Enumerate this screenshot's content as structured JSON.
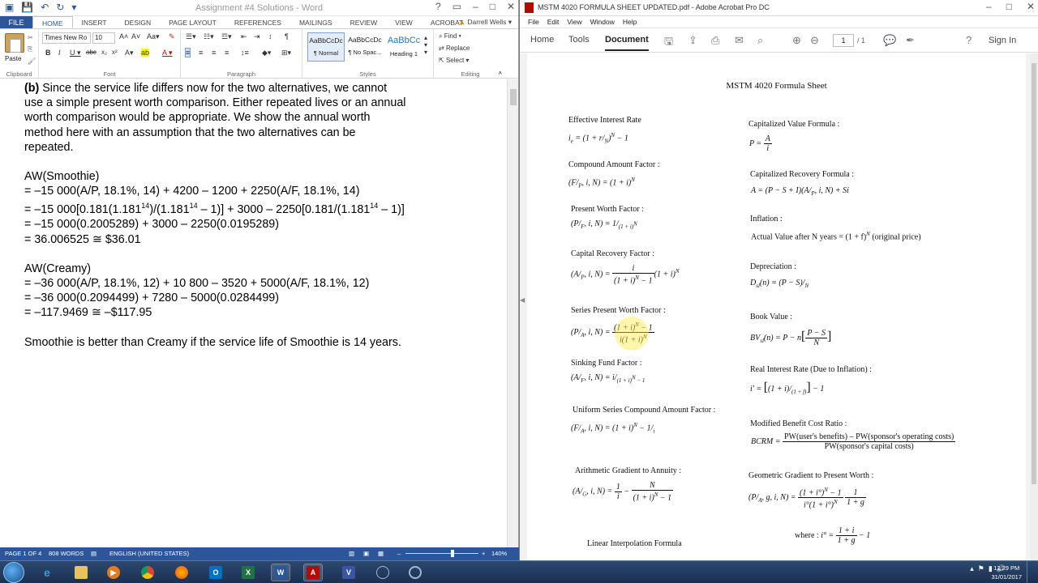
{
  "word": {
    "title": "Assignment #4 Solutions - Word",
    "tabs": [
      "FILE",
      "HOME",
      "INSERT",
      "DESIGN",
      "PAGE LAYOUT",
      "REFERENCES",
      "MAILINGS",
      "REVIEW",
      "VIEW",
      "ACROBAT"
    ],
    "active_tab": "HOME",
    "user": "Darrell Wells",
    "ribbon": {
      "font_name": "Times New Ro",
      "font_size": "10",
      "paste_label": "Paste",
      "groups": [
        "Clipboard",
        "Font",
        "Paragraph",
        "Styles",
        "Editing"
      ],
      "styles": [
        {
          "preview": "AaBbCcDc",
          "name": "¶ Normal"
        },
        {
          "preview": "AaBbCcDc",
          "name": "¶ No Spac..."
        },
        {
          "preview": "AaBbCc",
          "name": "Heading 1"
        }
      ],
      "editing": [
        "Find",
        "Replace",
        "Select"
      ]
    },
    "doc": {
      "para_b_label": "(b)",
      "para_b_line1": " Since the service life differs now for the two alternatives, we cannot",
      "para_b_lines": [
        "use a simple present worth comparison. Either repeated lives or an annual",
        "worth comparison would be appropriate. We show the annual worth",
        "method here with an assumption that the two alternatives can be",
        "repeated."
      ],
      "smoothie_head": "AW(Smoothie)",
      "smoothie_l1": "= –15 000(A/P, 18.1%, 14) + 4200 – 1200 + 2250(A/F, 18.1%, 14)",
      "smoothie_l2": "= –15 000[0.181(1.181",
      "smoothie_l2_sup1": "14",
      "smoothie_l2_b": ")/(1.181",
      "smoothie_l2_sup2": "14",
      "smoothie_l2_c": " – 1)] + 3000 – 2250[0.181/(1.181",
      "smoothie_l2_sup3": "14",
      "smoothie_l2_d": " – 1)]",
      "smoothie_l3": "= –15 000(0.2005289) + 3000 – 2250(0.0195289)",
      "smoothie_l4": "= 36.006525 ≅ $36.01",
      "creamy_head": "AW(Creamy)",
      "creamy_l1": "= –36 000(A/P, 18.1%, 12) + 10 800 – 3520 + 5000(A/F, 18.1%, 12)",
      "creamy_l2": "= –36 000(0.2094499) + 7280 – 5000(0.0284499)",
      "creamy_l3": "= –117.9469 ≅ –$117.95",
      "conclusion": "Smoothie is better than Creamy if the service life of Smoothie is 14 years."
    },
    "status": {
      "page": "PAGE 1 OF 4",
      "words": "808 WORDS",
      "language": "ENGLISH (UNITED STATES)",
      "zoom": "140%"
    }
  },
  "acrobat": {
    "title": "MSTM 4020 FORMULA SHEET UPDATED.pdf - Adobe Acrobat Pro DC",
    "menu": [
      "File",
      "Edit",
      "View",
      "Window",
      "Help"
    ],
    "nav": [
      "Home",
      "Tools",
      "Document"
    ],
    "active_nav": "Document",
    "page_current": "1",
    "page_total": "/ 1",
    "sign_in": "Sign In",
    "sheet": {
      "title": "MSTM 4020 Formula Sheet",
      "left_labels": [
        "Effective Interest Rate",
        "Compound Amount Factor :",
        "Present Worth Factor :",
        "Capital Recovery Factor :",
        "Series Present Worth Factor :",
        "Sinking Fund Factor :",
        "Uniform Series Compound Amount Factor :",
        "Arithmetic Gradient to Annuity :",
        "Linear Interpolation Formula"
      ],
      "right_labels": [
        "Capitalized Value Formula :",
        "Capitalized Recovery Formula :",
        "Inflation :",
        "Depreciation :",
        "Book Value :",
        "Real Interest Rate (Due to Inflation) :",
        "Modified Benefit Cost Ratio :",
        "Geometric Gradient to Present Worth :"
      ],
      "actual_value": "Actual Value after N years = (1 + f)",
      "actual_value_tail": " (original price)",
      "bcrm_num": "PW(user's benefits) – PW(sponsor's operating costs)",
      "bcrm_den": "PW(sponsor's capital costs)",
      "where": "where :"
    }
  },
  "taskbar": {
    "time": "12:29 PM",
    "date": "31/01/2017"
  }
}
